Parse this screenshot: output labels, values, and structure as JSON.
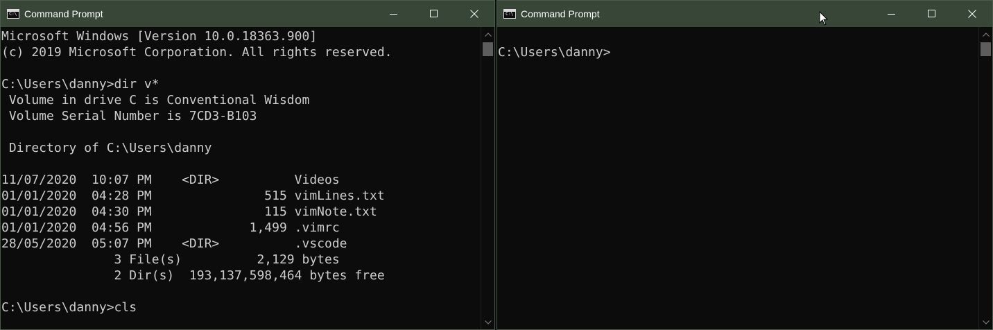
{
  "left_window": {
    "title": "Command Prompt",
    "icon": "cmd-icon",
    "icon_text": "C:\\",
    "lines": [
      "Microsoft Windows [Version 10.0.18363.900]",
      "(c) 2019 Microsoft Corporation. All rights reserved.",
      "",
      "C:\\Users\\danny>dir v*",
      " Volume in drive C is Conventional Wisdom",
      " Volume Serial Number is 7CD3-B103",
      "",
      " Directory of C:\\Users\\danny",
      "",
      "11/07/2020  10:07 PM    <DIR>          Videos",
      "01/01/2020  04:28 PM               515 vimLines.txt",
      "01/01/2020  04:30 PM               115 vimNote.txt",
      "01/01/2020  04:56 PM             1,499 .vimrc",
      "28/05/2020  05:07 PM    <DIR>          .vscode",
      "               3 File(s)          2,129 bytes",
      "               2 Dir(s)  193,137,598,464 bytes free",
      "",
      "C:\\Users\\danny>cls"
    ]
  },
  "right_window": {
    "title": "Command Prompt",
    "icon": "cmd-icon",
    "icon_text": "C:\\",
    "lines": [
      "",
      "C:\\Users\\danny>"
    ]
  },
  "caption_buttons": {
    "minimize": "minimize-icon",
    "maximize": "maximize-icon",
    "close": "close-icon"
  },
  "colors": {
    "titlebar": "#374637",
    "console_bg": "#0c0c0c",
    "console_fg": "#cccccc",
    "scroll_thumb": "#5d5d5d"
  }
}
